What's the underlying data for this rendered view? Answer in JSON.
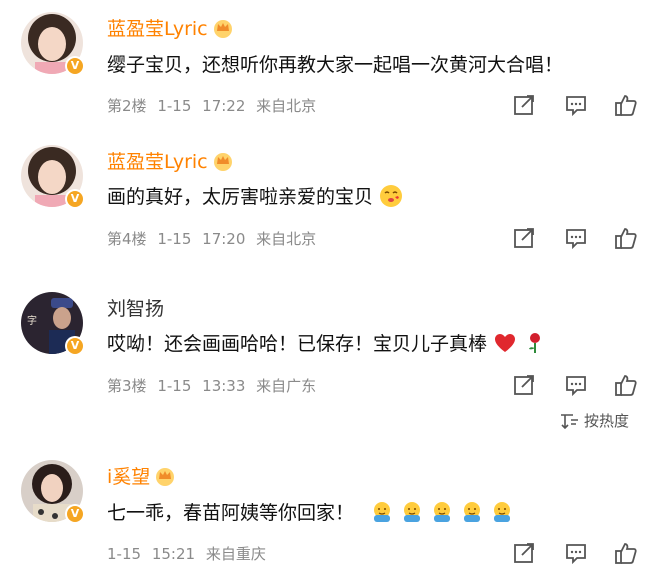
{
  "comments": [
    {
      "author": "蓝盈莹Lyric",
      "text": "缨子宝贝，还想听你再教大家一起唱一次黄河大合唱！",
      "floor": "第2楼",
      "date": "1-15",
      "time": "17:22",
      "location": "来自北京",
      "author_color": "#ff8200",
      "emojis": []
    },
    {
      "author": "蓝盈莹Lyric",
      "text": "画的真好，太厉害啦亲爱的宝贝",
      "floor": "第4楼",
      "date": "1-15",
      "time": "17:20",
      "location": "来自北京",
      "author_color": "#ff8200",
      "emojis": [
        "kissing-face-emoji"
      ]
    },
    {
      "author": "刘智扬",
      "text": "哎呦！还会画画哈哈！已保存！宝贝儿子真棒",
      "floor": "第3楼",
      "date": "1-15",
      "time": "13:33",
      "location": "来自广东",
      "author_color": "#333333",
      "emojis": [
        "red-heart-emoji",
        "rose-emoji"
      ]
    },
    {
      "author": "i奚望",
      "text": "七一乖，春苗阿姨等你回家！",
      "floor": "",
      "date": "1-15",
      "time": "15:21",
      "location": "来自重庆",
      "author_color": "#ff8200",
      "emojis": [
        "hug-emoji",
        "hug-emoji",
        "hug-emoji",
        "hug-emoji",
        "hug-emoji"
      ]
    }
  ],
  "sort": {
    "label": "按热度",
    "icon": "sort-icon"
  },
  "icons": {
    "share": "share-icon",
    "comment": "comment-icon",
    "like": "thumbs-up-icon",
    "verified": "verified-badge-icon",
    "crown": "crown-icon"
  },
  "verified_mark": "V",
  "colors": {
    "accent": "#ff8200",
    "meta": "#8a8a8a",
    "badge": "#f5a623"
  }
}
